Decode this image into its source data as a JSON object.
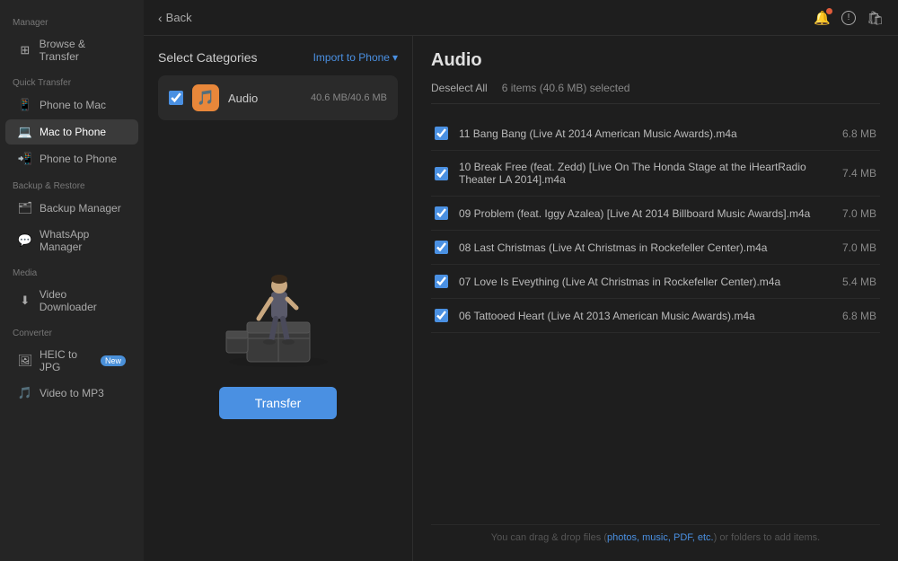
{
  "sidebar": {
    "manager_label": "Manager",
    "quick_transfer_label": "Quick Transfer",
    "backup_restore_label": "Backup & Restore",
    "media_label": "Media",
    "converter_label": "Converter",
    "items": {
      "browse_transfer": "Browse & Transfer",
      "phone_to_mac": "Phone to Mac",
      "mac_to_phone": "Mac to Phone",
      "phone_to_phone": "Phone to Phone",
      "backup_manager": "Backup Manager",
      "whatsapp_manager": "WhatsApp Manager",
      "video_downloader": "Video Downloader",
      "heic_to_jpg": "HEIC to JPG",
      "video_to_mp3": "Video to MP3",
      "new_badge": "New"
    }
  },
  "topbar": {
    "back_label": "Back"
  },
  "left_panel": {
    "title": "Select Categories",
    "import_btn": "Import to Phone",
    "category": {
      "name": "Audio",
      "size": "40.6 MB/40.6 MB"
    },
    "transfer_btn": "Transfer"
  },
  "right_panel": {
    "title": "Audio",
    "deselect_all": "Deselect All",
    "items_selected": "6 items (40.6 MB) selected",
    "files": [
      {
        "name": "11 Bang Bang (Live At 2014 American Music Awards).m4a",
        "size": "6.8 MB"
      },
      {
        "name": "10 Break Free (feat. Zedd) [Live On The Honda Stage at the iHeartRadio Theater LA 2014].m4a",
        "size": "7.4 MB"
      },
      {
        "name": "09 Problem (feat. Iggy Azalea)  [Live At 2014 Billboard Music Awards].m4a",
        "size": "7.0 MB"
      },
      {
        "name": "08 Last Christmas  (Live At Christmas in Rockefeller Center).m4a",
        "size": "7.0 MB"
      },
      {
        "name": "07 Love Is Eveything (Live At Christmas in Rockefeller Center).m4a",
        "size": "5.4 MB"
      },
      {
        "name": "06 Tattooed Heart (Live At 2013 American Music Awards).m4a",
        "size": "6.8 MB"
      }
    ],
    "drag_drop_prefix": "You can drag & drop files (",
    "drag_drop_link": "photos, music, PDF, etc.",
    "drag_drop_suffix": ") or folders to add items."
  }
}
